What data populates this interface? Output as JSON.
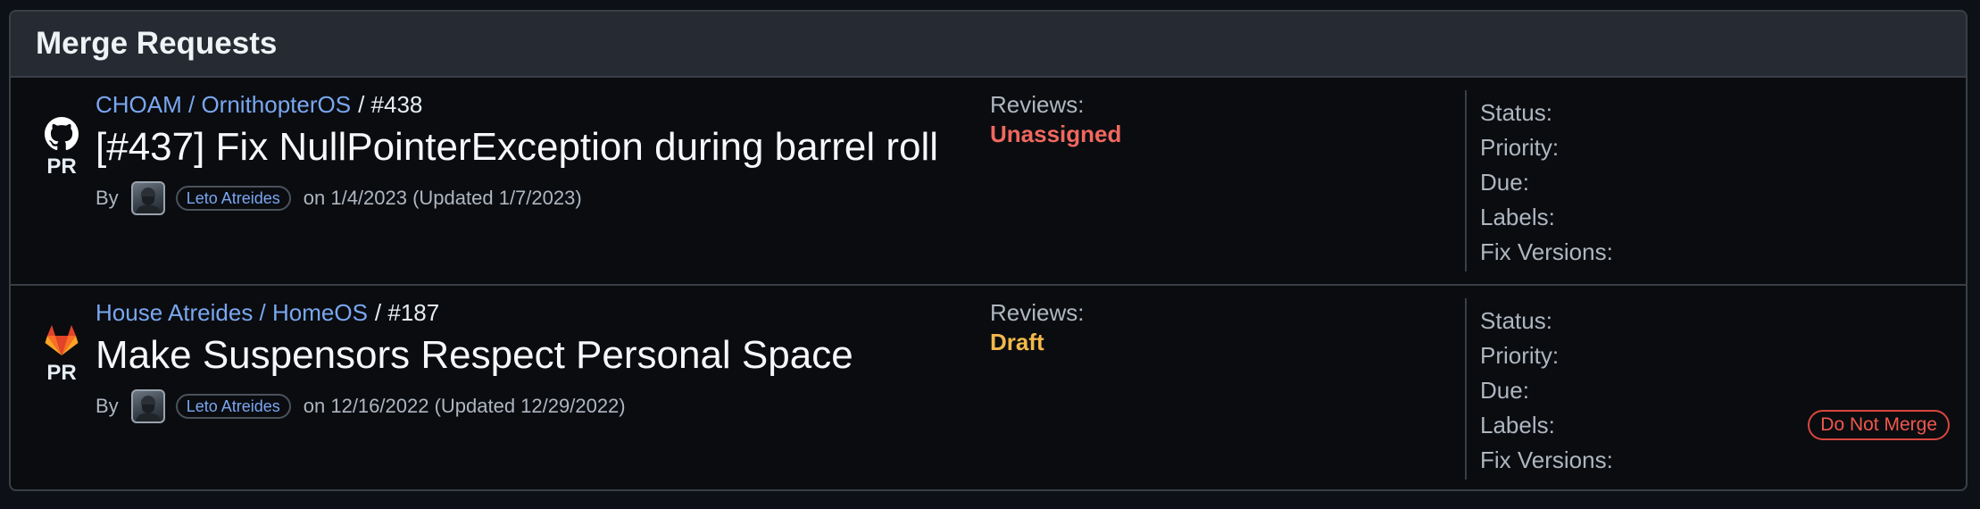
{
  "panel": {
    "title": "Merge Requests"
  },
  "merge_requests": [
    {
      "source_icon": "github-icon",
      "kind": "PR",
      "repo": "CHOAM / OrnithopterOS",
      "number": "/ #438",
      "title": "[#437] Fix NullPointerException during barrel roll",
      "by_label": "By",
      "author": "Leto Atreides",
      "dates": "on 1/4/2023 (Updated 1/7/2023)",
      "reviews_label": "Reviews:",
      "reviews_value": "Unassigned",
      "reviews_color": "#f0685e",
      "meta": {
        "status": "Status:",
        "priority": "Priority:",
        "due": "Due:",
        "labels": "Labels:",
        "fix_versions": "Fix Versions:"
      },
      "label_badge": ""
    },
    {
      "source_icon": "gitlab-icon",
      "kind": "PR",
      "repo": "House Atreides / HomeOS",
      "number": "/ #187",
      "title": "Make Suspensors Respect Personal Space",
      "by_label": "By",
      "author": "Leto Atreides",
      "dates": "on 12/16/2022 (Updated 12/29/2022)",
      "reviews_label": "Reviews:",
      "reviews_value": "Draft",
      "reviews_color": "#f2b84b",
      "meta": {
        "status": "Status:",
        "priority": "Priority:",
        "due": "Due:",
        "labels": "Labels:",
        "fix_versions": "Fix Versions:"
      },
      "label_badge": "Do Not Merge"
    }
  ],
  "colors": {
    "background": "#0d1117",
    "link": "#7aa7f0",
    "unassigned": "#f0685e",
    "draft": "#f2b84b",
    "do_not_merge": "#f0584b"
  }
}
